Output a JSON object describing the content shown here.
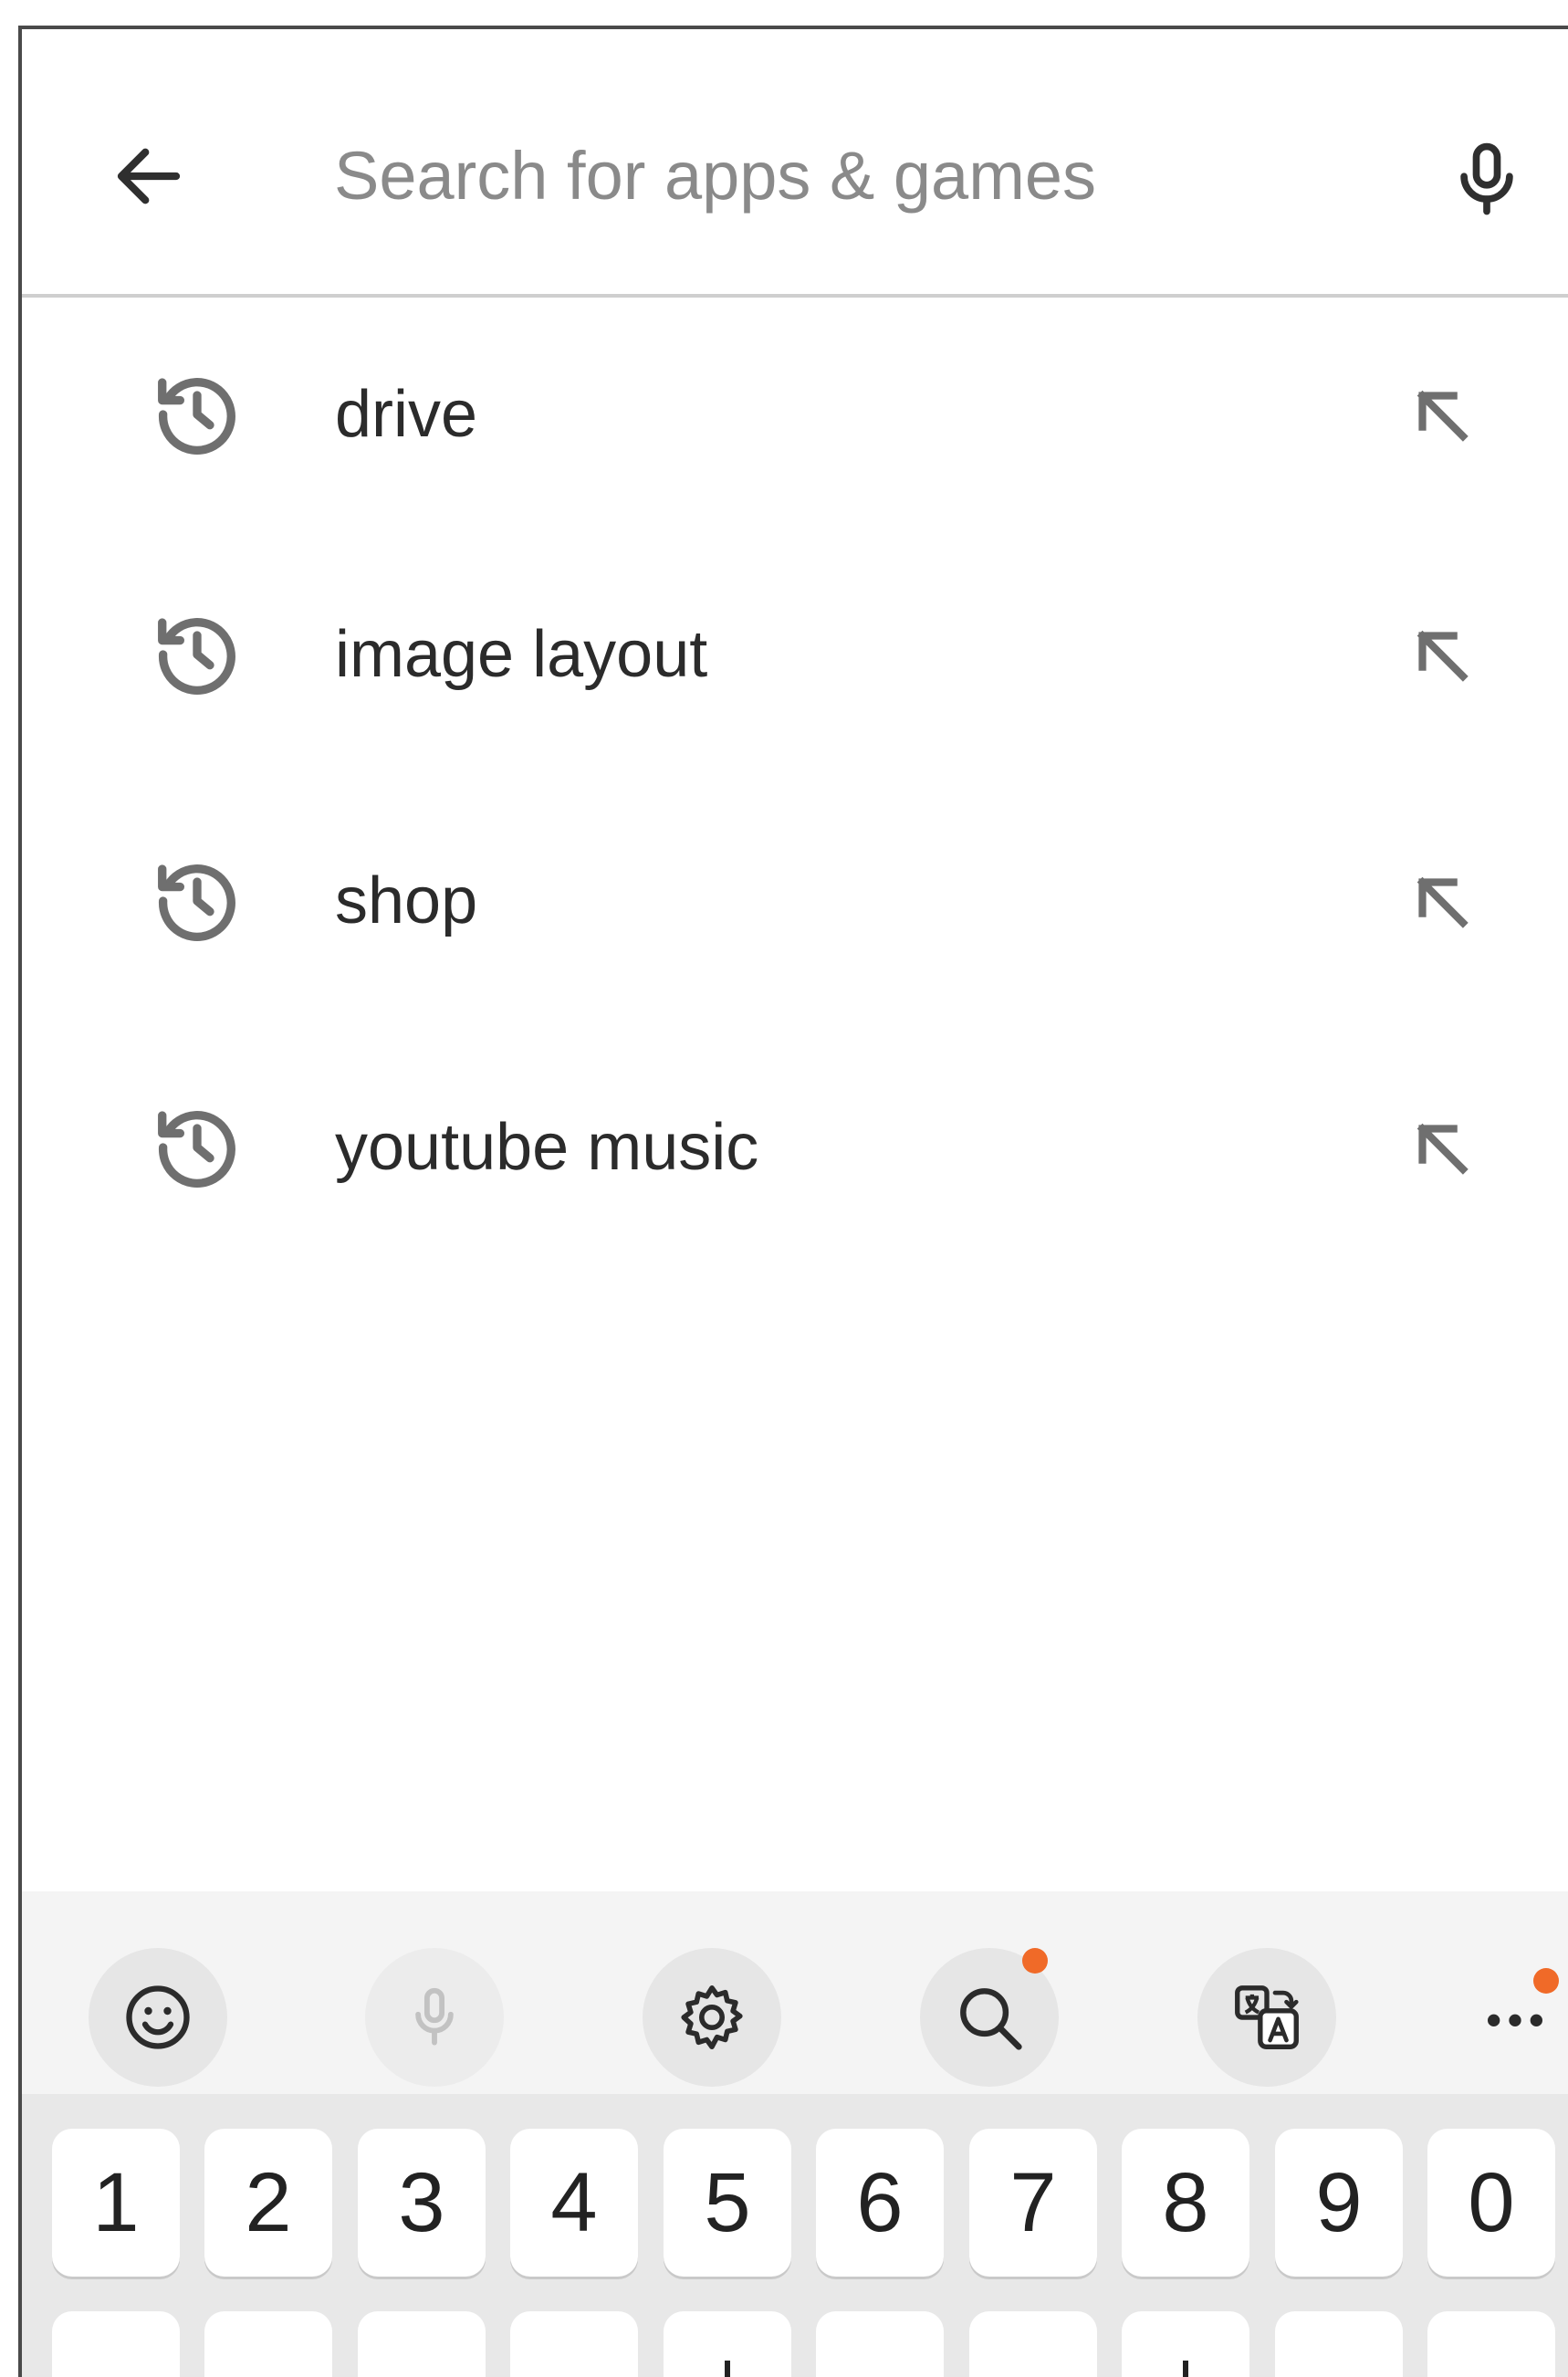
{
  "search": {
    "placeholder": "Search for apps & games",
    "back_icon": "arrow-back-icon",
    "mic_icon": "microphone-icon"
  },
  "suggestions": [
    {
      "label": "drive",
      "icon": "history-icon",
      "action_icon": "arrow-up-left-icon"
    },
    {
      "label": "image layout",
      "icon": "history-icon",
      "action_icon": "arrow-up-left-icon"
    },
    {
      "label": "shop",
      "icon": "history-icon",
      "action_icon": "arrow-up-left-icon"
    },
    {
      "label": "youtube music",
      "icon": "history-icon",
      "action_icon": "arrow-up-left-icon"
    }
  ],
  "keyboard": {
    "toolbar": [
      {
        "icon": "emoji-icon"
      },
      {
        "icon": "microphone-icon",
        "disabled": true
      },
      {
        "icon": "gear-icon"
      },
      {
        "icon": "search-icon",
        "badge": true
      },
      {
        "icon": "translate-icon"
      },
      {
        "icon": "more-icon",
        "badge": true
      }
    ],
    "number_row": [
      "1",
      "2",
      "3",
      "4",
      "5",
      "6",
      "7",
      "8",
      "9",
      "0"
    ]
  },
  "colors": {
    "icon_gray": "#6f6f6f",
    "text_dark": "#2b2b2b",
    "placeholder": "#8a8a8a",
    "divider": "#cfcfcf",
    "badge_orange": "#f06a28",
    "keyboard_bg": "#e8e8e8"
  }
}
